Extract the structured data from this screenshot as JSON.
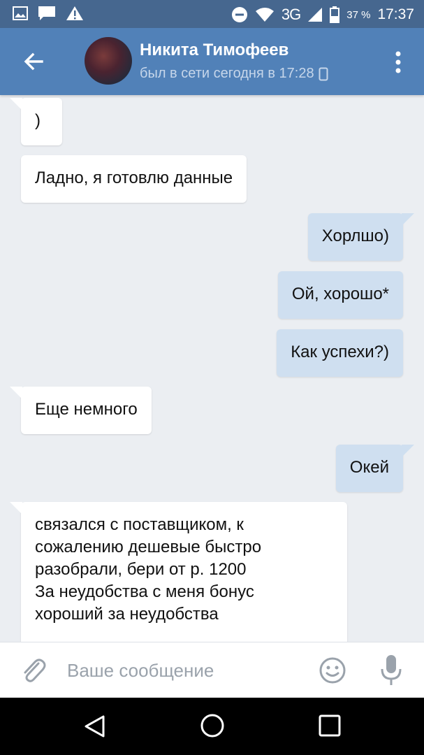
{
  "status_bar": {
    "network": "3G",
    "battery": "37 %",
    "time": "17:37",
    "icons": [
      "image-icon",
      "chat-icon",
      "warning-icon",
      "dnd-icon",
      "wifi-icon",
      "signal-icon",
      "battery-icon"
    ]
  },
  "header": {
    "contact_name": "Никита Тимофеев",
    "last_seen": "был в сети сегодня в 17:28",
    "icons": [
      "back-arrow-icon",
      "phone-icon",
      "more-vert-icon"
    ]
  },
  "messages": [
    {
      "direction": "incoming",
      "text": ")"
    },
    {
      "direction": "incoming",
      "text": "Ладно, я готовлю данные"
    },
    {
      "direction": "outgoing",
      "text": "Хорлшо)"
    },
    {
      "direction": "outgoing",
      "text": "Ой, хорошо*"
    },
    {
      "direction": "outgoing",
      "text": "Как успехи?)"
    },
    {
      "direction": "incoming",
      "text": "Еще немного"
    },
    {
      "direction": "outgoing",
      "text": "Окей"
    },
    {
      "direction": "incoming",
      "lines": [
        "связался с поставщиком, к",
        "сожалению дешевые быстро",
        "разобрали, бери от р. 1200",
        "За неудобства с меня бонус",
        "хороший за неудобства"
      ]
    }
  ],
  "composer": {
    "placeholder": "Ваше сообщение",
    "icons": [
      "paperclip-icon",
      "emoji-icon",
      "mic-icon"
    ]
  },
  "nav_bar": {
    "icons": [
      "nav-back-icon",
      "nav-home-icon",
      "nav-recent-icon"
    ]
  },
  "colors": {
    "header": "#5181b8",
    "status_bar": "#46678f",
    "background": "#ebeef2",
    "outgoing_bubble": "#cfdff0",
    "incoming_bubble": "#ffffff"
  }
}
